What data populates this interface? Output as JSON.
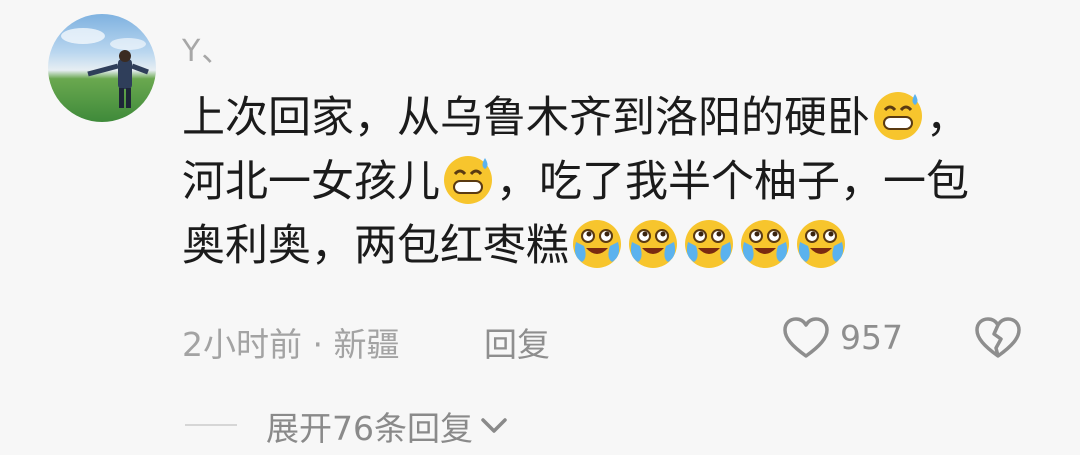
{
  "comment": {
    "username": "Y、",
    "text_parts": [
      "上次回家，从乌鲁木齐到洛阳的硬卧",
      "，",
      "河北一女孩儿",
      "，吃了我半个柚子，一包",
      "奥利奥，两包红枣糕"
    ],
    "emojis": {
      "sweat_grin": "sweat-grin-emoji",
      "tears_of_joy": "tears-of-joy-emoji"
    },
    "time": "2小时前",
    "separator": "·",
    "location": "新疆",
    "reply_label": "回复",
    "like_count": "957",
    "expand_replies": "展开76条回复"
  },
  "colors": {
    "background": "#f7f7f7",
    "text": "#1b1b1b",
    "muted": "#a3a3a3",
    "emoji_face": "#f7c52d"
  },
  "icons": [
    "heart-icon",
    "broken-heart-icon",
    "chevron-down-icon"
  ]
}
